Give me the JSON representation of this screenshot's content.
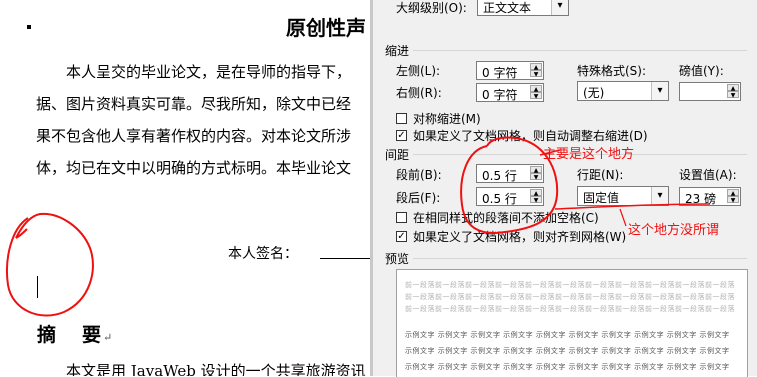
{
  "document": {
    "title": "原创性声",
    "paragraph_lines": [
      "本人呈交的毕业论文，是在导师的指导下，",
      "据、图片资料真实可靠。尽我所知，除文中已经",
      "果不包含他人享有著作权的内容。对本论文所涉",
      "体，均已在文中以明确的方式标明。本毕业论文"
    ],
    "signature_label": "本人签名：",
    "abstract_heading_1": "摘",
    "abstract_heading_2": "要",
    "return_mark": "↵",
    "body_line": "本文是用 JavaWeb 设计的一个共享旅游资讯"
  },
  "dialog": {
    "outline_level_label": "大纲级别(O):",
    "outline_level_value": "正文文本",
    "indent_section": "缩进",
    "left_label": "左侧(L):",
    "left_value": "0 字符",
    "right_label": "右侧(R):",
    "right_value": "0 字符",
    "special_format_label": "特殊格式(S):",
    "special_format_value": "(无)",
    "measure_label": "磅值(Y):",
    "measure_value": "",
    "mirror_indent_label": "对称缩进(M)",
    "mirror_indent_checked": false,
    "auto_adjust_label": "如果定义了文档网格，则自动调整右缩进(D)",
    "auto_adjust_checked": true,
    "spacing_section": "间距",
    "before_label": "段前(B):",
    "before_value": "0.5 行",
    "after_label": "段后(F):",
    "after_value": "0.5 行",
    "line_spacing_label": "行距(N):",
    "line_spacing_value": "固定值",
    "at_label": "设置值(A):",
    "at_value": "23 磅",
    "no_space_same_style_label": "在相同样式的段落间不添加空格(C)",
    "no_space_same_style_checked": false,
    "snap_grid_label": "如果定义了文档网格，则对齐到网格(W)",
    "snap_grid_checked": true,
    "preview_section": "预览",
    "preview_prev_text": "前一段落前一段落前一段落前一段落前一段落前一段落前一段落前一段落前一段落前一段落前一段落",
    "preview_sample_text": "示例文字 示例文字 示例文字 示例文字 示例文字 示例文字 示例文字 示例文字 示例文字 示例文字",
    "check_mark": "✓",
    "spin_up": "▲",
    "spin_down": "▼",
    "dropdown_arrow": "▾"
  },
  "annotations": {
    "main_place": "主要是这个地方",
    "doesnt_matter": "这个地方没所谓"
  },
  "colors": {
    "annotation_red": "#f01010",
    "dialog_bg": "#f0f0f0"
  }
}
